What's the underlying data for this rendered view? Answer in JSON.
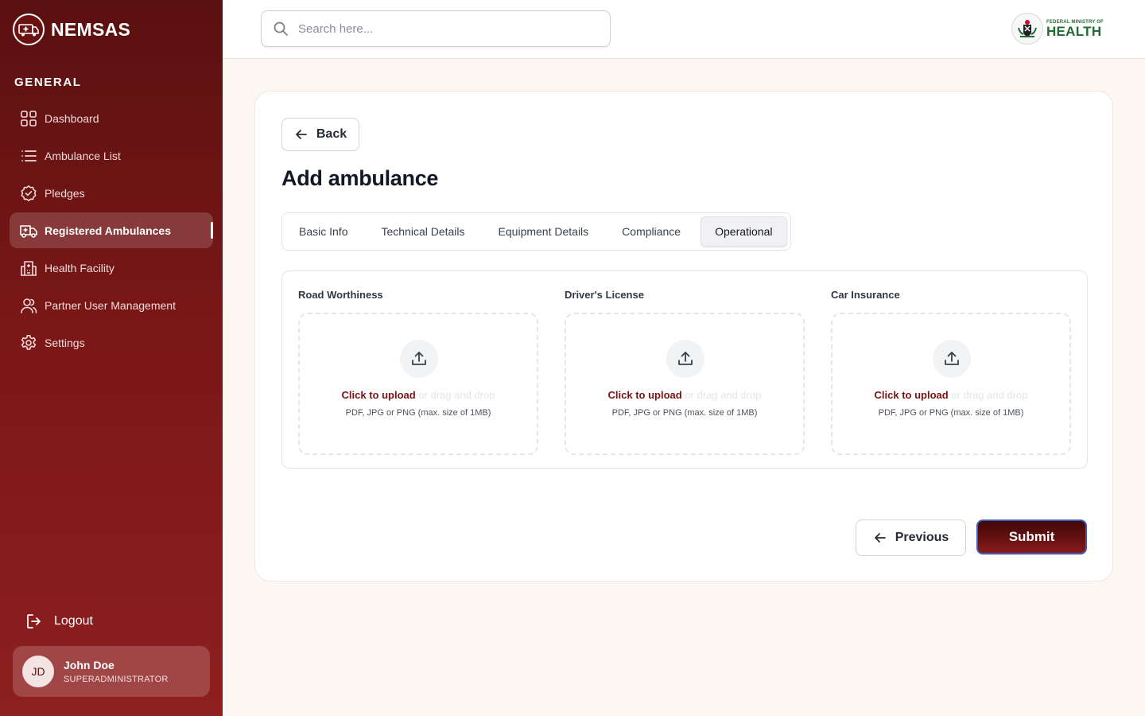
{
  "app": {
    "brand_name": "NEMSAS",
    "logo_text": "NEMSAS",
    "colors": {
      "primary": "#7a1717",
      "accent": "#7a1414",
      "focus_ring": "#3f5bb8",
      "ministry_green": "#1f6b33"
    }
  },
  "sidebar": {
    "section_label": "GENERAL",
    "items": [
      {
        "label": "Dashboard",
        "icon": "grid-icon",
        "active": false
      },
      {
        "label": "Ambulance List",
        "icon": "list-icon",
        "active": false
      },
      {
        "label": "Pledges",
        "icon": "badge-check-icon",
        "active": false
      },
      {
        "label": "Registered Ambulances",
        "icon": "ambulance-icon",
        "active": true
      },
      {
        "label": "Health Facility",
        "icon": "hospital-icon",
        "active": false
      },
      {
        "label": "Partner User Management",
        "icon": "users-icon",
        "active": false
      },
      {
        "label": "Settings",
        "icon": "gear-icon",
        "active": false
      }
    ],
    "logout_label": "Logout",
    "user": {
      "initials": "JD",
      "name": "John Doe",
      "role": "SUPERADMINISTRATOR"
    }
  },
  "header": {
    "search_placeholder": "Search here...",
    "ministry_small": "FEDERAL MINISTRY OF",
    "ministry_big": "HEALTH"
  },
  "main": {
    "back_label": "Back",
    "title": "Add ambulance",
    "tabs": [
      {
        "label": "Basic Info",
        "active": false
      },
      {
        "label": "Technical Details",
        "active": false
      },
      {
        "label": "Equipment Details",
        "active": false
      },
      {
        "label": "Compliance",
        "active": false
      },
      {
        "label": "Operational",
        "active": true
      }
    ],
    "uploads": [
      {
        "label": "Road Worthiness",
        "cta": "Click to upload",
        "rest": " or drag and drop",
        "hint": "PDF, JPG or PNG (max. size of 1MB)"
      },
      {
        "label": "Driver's License",
        "cta": "Click to upload",
        "rest": " or drag and drop",
        "hint": "PDF, JPG or PNG (max. size of 1MB)"
      },
      {
        "label": "Car Insurance",
        "cta": "Click to upload",
        "rest": " or drag and drop",
        "hint": "PDF, JPG or PNG (max. size of 1MB)"
      }
    ],
    "previous_label": "Previous",
    "submit_label": "Submit"
  }
}
